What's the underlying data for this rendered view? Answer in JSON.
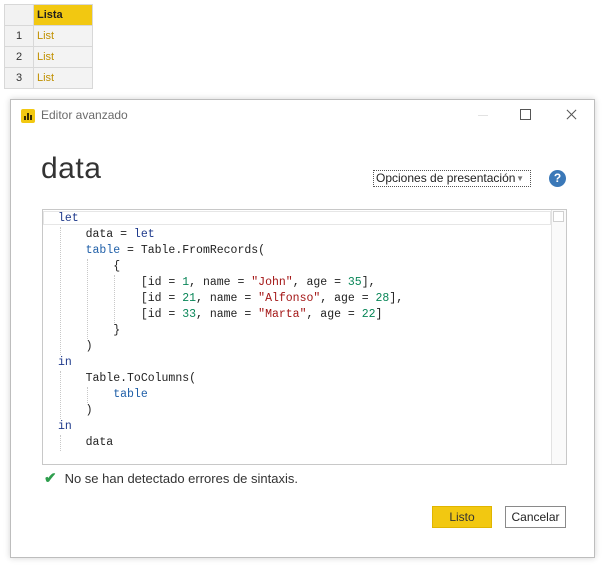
{
  "background_table": {
    "header": "Lista",
    "rows": [
      {
        "index": "1",
        "value": "List"
      },
      {
        "index": "2",
        "value": "List"
      },
      {
        "index": "3",
        "value": "List"
      }
    ]
  },
  "dialog": {
    "title": "Editor avanzado",
    "query_name": "data",
    "presentation_dropdown": "Opciones de presentación",
    "help_icon": "question-circle-icon",
    "status_text": "No se han detectado errores de sintaxis.",
    "buttons": {
      "done": "Listo",
      "cancel": "Cancelar"
    }
  },
  "code_lines": [
    "let",
    "    data = let",
    "    table = Table.FromRecords(",
    "        {",
    "            [id = 1, name = \"John\", age = 35],",
    "            [id = 21, name = \"Alfonso\", age = 28],",
    "            [id = 33, name = \"Marta\", age = 22]",
    "        }",
    "    )",
    "in",
    "    Table.ToColumns(",
    "        table",
    "    )",
    "in",
    "    data"
  ],
  "colors": {
    "accent": "#f2c811",
    "keyword": "#1f3a8c",
    "string": "#a31515",
    "number": "#098658",
    "success": "#2e9e4d",
    "help": "#3a78b8"
  }
}
